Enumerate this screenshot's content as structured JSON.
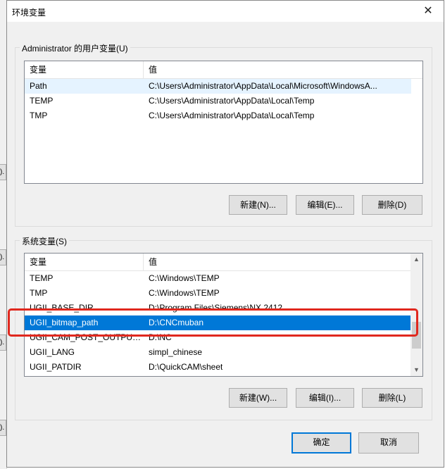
{
  "background_window": {
    "button_fragments": [
      ").",
      ").",
      ").",
      ")."
    ]
  },
  "dialog": {
    "title": "环境变量",
    "close_glyph": "✕",
    "user_section": {
      "label": "Administrator 的用户变量(U)",
      "columns": [
        "变量",
        "值"
      ],
      "rows": [
        {
          "name": "Path",
          "value": "C:\\Users\\Administrator\\AppData\\Local\\Microsoft\\WindowsA..."
        },
        {
          "name": "TEMP",
          "value": "C:\\Users\\Administrator\\AppData\\Local\\Temp"
        },
        {
          "name": "TMP",
          "value": "C:\\Users\\Administrator\\AppData\\Local\\Temp"
        }
      ],
      "buttons": {
        "new": "新建(N)...",
        "edit": "编辑(E)...",
        "delete": "删除(D)"
      }
    },
    "system_section": {
      "label": "系统变量(S)",
      "columns": [
        "变量",
        "值"
      ],
      "rows": [
        {
          "name": "TEMP",
          "value": "C:\\Windows\\TEMP"
        },
        {
          "name": "TMP",
          "value": "C:\\Windows\\TEMP"
        },
        {
          "name": "UGII_BASE_DIR",
          "value": "D:\\Program Files\\Siemens\\NX 2412"
        },
        {
          "name": "UGII_bitmap_path",
          "value": "D:\\CNCmuban"
        },
        {
          "name": "UGII_CAM_POST_OUTPUT...",
          "value": "D:\\NC"
        },
        {
          "name": "UGII_LANG",
          "value": "simpl_chinese"
        },
        {
          "name": "UGII_PATDIR",
          "value": "D:\\QuickCAM\\sheet"
        }
      ],
      "selected_row": "UGII_bitmap_path",
      "buttons": {
        "new": "新建(W)...",
        "edit": "编辑(I)...",
        "delete": "删除(L)"
      }
    },
    "footer": {
      "ok": "确定",
      "cancel": "取消"
    },
    "colors": {
      "selection": "#0078d7",
      "annotation": "#e0281e"
    }
  }
}
